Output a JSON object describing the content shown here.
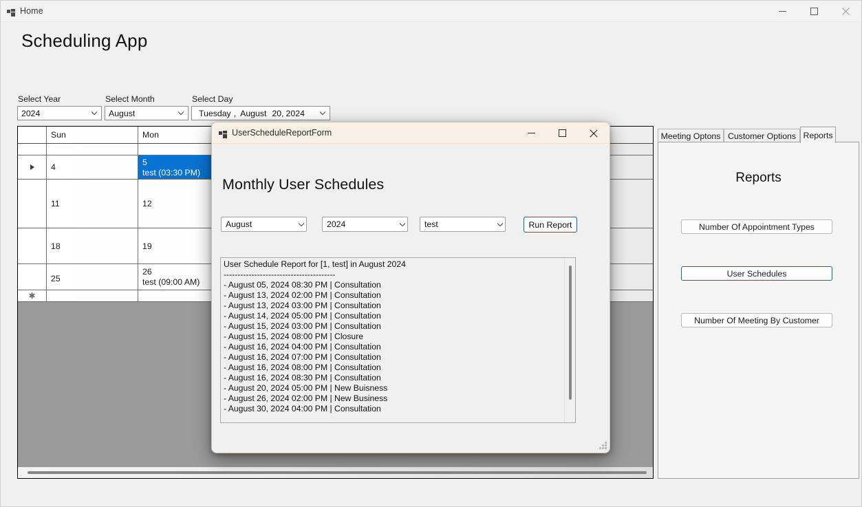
{
  "window": {
    "title": "Home",
    "icon": "app-window-icon",
    "minimize_label": "Minimize",
    "maximize_label": "Maximize",
    "close_label": "Close"
  },
  "app": {
    "heading": "Scheduling App"
  },
  "selectors": [
    {
      "label": "Select Year",
      "value": "2024",
      "icon": "chevron-down-icon"
    },
    {
      "label": "Select Month",
      "value": "August",
      "icon": "chevron-down-icon"
    }
  ],
  "day_selector": {
    "label": "Select Day",
    "weekday": "Tuesday",
    "comma": ",",
    "month": "August",
    "daynumber": "20,",
    "year": "2024",
    "icon": "chevron-down-icon"
  },
  "calendar": {
    "columns": [
      "",
      "Sun",
      "Mon",
      "",
      "",
      "",
      "",
      ""
    ],
    "rows": [
      {
        "marker": "",
        "cells": [
          "",
          "",
          "",
          "",
          "",
          "",
          ""
        ]
      },
      {
        "marker": "arrow",
        "cells": [
          "4",
          "5",
          "",
          "",
          "",
          "",
          ""
        ],
        "appointments": [
          "",
          "test (03:30 PM)",
          "",
          "",
          "",
          "",
          ""
        ],
        "selected_col": 1
      },
      {
        "marker": "",
        "cells": [
          "11",
          "12",
          "",
          "",
          "",
          "",
          ""
        ]
      },
      {
        "marker": "",
        "cells": [
          "18",
          "19",
          "",
          "",
          "",
          "",
          ""
        ]
      },
      {
        "marker": "",
        "cells": [
          "25",
          "26",
          "",
          "",
          "",
          "",
          ""
        ],
        "appointments": [
          "",
          "test (09:00 AM)",
          "",
          "",
          "",
          "",
          ""
        ]
      },
      {
        "marker": "new",
        "cells": [
          "",
          "",
          "",
          "",
          "",
          "",
          ""
        ]
      }
    ],
    "selection_color": "#0a72d0",
    "scrollbar": "horizontal"
  },
  "tabs": {
    "items": [
      {
        "label": "Meeting Optons",
        "active": false
      },
      {
        "label": "Customer Options",
        "active": false
      },
      {
        "label": "Reports",
        "active": true
      }
    ],
    "reports_panel": {
      "title": "Reports",
      "buttons": [
        {
          "label": "Number Of Appointment Types",
          "focused": false
        },
        {
          "label": "User Schedules",
          "focused": true
        },
        {
          "label": "Number Of Meeting By Customer",
          "focused": false
        }
      ],
      "focus_color": "#1268b3"
    }
  },
  "dialog": {
    "title": "UserScheduleReportForm",
    "icon": "app-window-icon",
    "minimize_label": "Minimize",
    "maximize_label": "Maximize",
    "close_label": "Close",
    "heading": "Monthly User Schedules",
    "titlebar_color": "#faf1e6",
    "filters": [
      {
        "name": "month-select",
        "value": "August",
        "icon": "chevron-down-icon"
      },
      {
        "name": "year-select",
        "value": "2024",
        "icon": "chevron-down-icon"
      },
      {
        "name": "user-select",
        "value": "test",
        "icon": "chevron-down-icon"
      }
    ],
    "run_button": {
      "label": "Run Report",
      "focus_color": "#1268b3"
    },
    "report": {
      "header": "User Schedule Report for [1, test] in August 2024",
      "divider": "----------------------------------------",
      "lines": [
        "- August 05, 2024 08:30 PM | Consultation",
        "- August 13, 2024 02:00 PM | Consultation",
        "- August 13, 2024 03:00 PM | Consultation",
        "- August 14, 2024 05:00 PM | Consultation",
        "- August 15, 2024 03:00 PM | Consultation",
        "- August 15, 2024 08:00 PM | Closure",
        "- August 16, 2024 04:00 PM | Consultation",
        "- August 16, 2024 07:00 PM | Consultation",
        "- August 16, 2024 08:00 PM | Consultation",
        "- August 16, 2024 08:30 PM | Consultation",
        "- August 20, 2024 05:00 PM | New Buisness",
        "- August 26, 2024 02:00 PM | New Business",
        "- August 30, 2024 04:00 PM | Consultation"
      ],
      "full_text": "User Schedule Report for [1, test] in August 2024\n----------------------------------------\n- August 05, 2024 08:30 PM | Consultation\n- August 13, 2024 02:00 PM | Consultation\n- August 13, 2024 03:00 PM | Consultation\n- August 14, 2024 05:00 PM | Consultation\n- August 15, 2024 03:00 PM | Consultation\n- August 15, 2024 08:00 PM | Closure\n- August 16, 2024 04:00 PM | Consultation\n- August 16, 2024 07:00 PM | Consultation\n- August 16, 2024 08:00 PM | Consultation\n- August 16, 2024 08:30 PM | Consultation\n- August 20, 2024 05:00 PM | New Buisness\n- August 26, 2024 02:00 PM | New Business\n- August 30, 2024 04:00 PM | Consultation"
    }
  }
}
